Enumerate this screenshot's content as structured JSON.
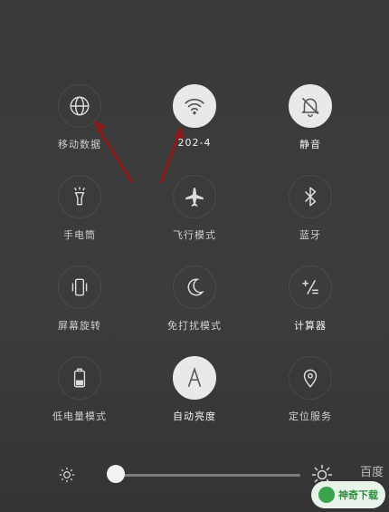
{
  "tiles": [
    {
      "label": "移动数据",
      "icon": "globe-icon",
      "active": false
    },
    {
      "label": "202-4",
      "icon": "wifi-icon",
      "active": true
    },
    {
      "label": "静音",
      "icon": "bell-muted-icon",
      "active": true
    },
    {
      "label": "手电筒",
      "icon": "flashlight-icon",
      "active": false
    },
    {
      "label": "飞行模式",
      "icon": "airplane-icon",
      "active": false
    },
    {
      "label": "蓝牙",
      "icon": "bluetooth-icon",
      "active": false
    },
    {
      "label": "屏幕旋转",
      "icon": "rotate-icon",
      "active": false
    },
    {
      "label": "免打扰模式",
      "icon": "moon-icon",
      "active": false
    },
    {
      "label": "计算器",
      "icon": "calculator-icon",
      "active": false
    },
    {
      "label": "低电量模式",
      "icon": "battery-icon",
      "active": false
    },
    {
      "label": "自动亮度",
      "icon": "auto-brightness-icon",
      "active": true
    },
    {
      "label": "定位服务",
      "icon": "location-icon",
      "active": false
    }
  ],
  "brightness": {
    "level": 0.01,
    "icon_low": "sun-small-icon",
    "icon_high": "sun-large-icon"
  },
  "watermark": {
    "text": "百度",
    "badge_text": "神奇下载"
  },
  "colors": {
    "bg": "#3a3a3a",
    "active_circle": "#e9e9e9",
    "arrow": "#8b1a1a"
  }
}
